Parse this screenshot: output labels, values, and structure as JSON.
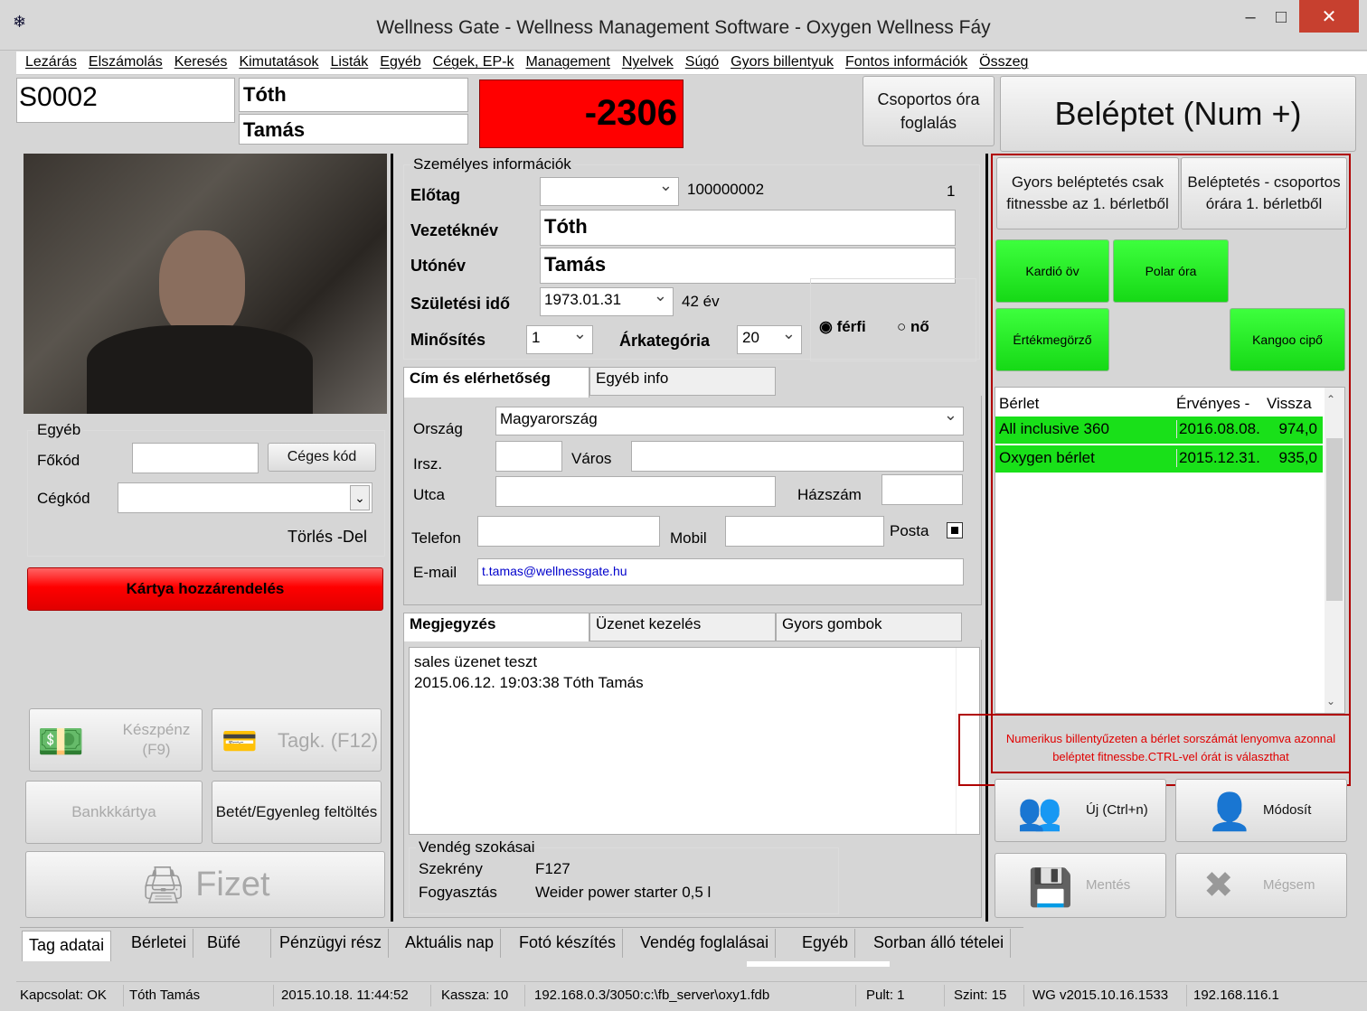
{
  "window": {
    "title": "Wellness Gate - Wellness Management Software - Oxygen Wellness Fáy"
  },
  "menu": [
    "Lezárás",
    "Elszámolás",
    "Keresés",
    "Kimutatások",
    "Listák",
    "Egyéb",
    "Cégek, EP-k",
    "Management",
    "Nyelvek",
    "Súgó",
    "Gyors billentyuk",
    "Fontos információk",
    "Összeg"
  ],
  "header": {
    "code": "S0002",
    "last_name": "Tóth",
    "first_name": "Tamás",
    "balance": "-2306",
    "group_booking": "Csoportos óra foglalás",
    "checkin": "Beléptet (Num +)"
  },
  "left": {
    "group_label": "Egyéb",
    "main_code_label": "Főkód",
    "company_code_button": "Céges kód",
    "company_code_label": "Cégkód",
    "delete_hint": "Törlés -Del",
    "card_assign": "Kártya hozzárendelés",
    "cash": "Készpénz (F9)",
    "member": "Tagk. (F12)",
    "bankcard": "Bankkkártya",
    "deposit": "Betét/Egyenleg feltöltés",
    "pay": "Fizet"
  },
  "personal": {
    "legend": "Személyes információk",
    "prefix_label": "Előtag",
    "prefix_value": "",
    "id": "100000002",
    "count": "1",
    "lastname_label": "Vezetéknév",
    "lastname": "Tóth",
    "firstname_label": "Utónév",
    "firstname": "Tamás",
    "birth_label": "Születési idő",
    "birth": "1973.01.31",
    "age": "42 év",
    "rating_label": "Minősítés",
    "rating": "1",
    "price_label": "Árkategória",
    "price": "20",
    "male": "férfi",
    "female": "nő"
  },
  "address_tabs": {
    "tab1": "Cím és elérhetőség",
    "tab2": "Egyéb info"
  },
  "address": {
    "country_label": "Ország",
    "country": "Magyarország",
    "zip_label": "Irsz.",
    "city_label": "Város",
    "street_label": "Utca",
    "house_label": "Házszám",
    "phone_label": "Telefon",
    "mobile_label": "Mobil",
    "post_label": "Posta",
    "email_label": "E-mail",
    "email": "t.tamas@wellnessgate.hu"
  },
  "note_tabs": {
    "tab1": "Megjegyzés",
    "tab2": "Üzenet kezelés",
    "tab3": "Gyors gombok"
  },
  "notes": {
    "line1": "sales üzenet teszt",
    "line2": "2015.06.12. 19:03:38 Tóth Tamás"
  },
  "habits": {
    "legend": "Vendég szokásai",
    "locker_label": "Szekrény",
    "locker": "F127",
    "consumption_label": "Fogyasztás",
    "consumption": "Weider power starter 0,5 l"
  },
  "right": {
    "quick_fitness": "Gyors beléptetés csak fitnessbe az 1. bérletből",
    "group_class": "Beléptetés - csoportos órára 1. bérletből",
    "kardio": "Kardió öv",
    "polar": "Polar óra",
    "valuables": "Értékmegörző",
    "kangoo": "Kangoo cipő",
    "table_headers": [
      "Bérlet",
      "Érvényes -",
      "Vissza"
    ],
    "passes": [
      {
        "name": "All inclusive 360",
        "valid": "2016.08.08.",
        "back": "974,0"
      },
      {
        "name": "Oxygen bérlet",
        "valid": "2015.12.31.",
        "back": "935,0"
      }
    ],
    "hint": "Numerikus billentyűzeten a bérlet sorszámát lenyomva azonnal beléptet fitnessbe.CTRL-vel órát is választhat",
    "new": "Új (Ctrl+n)",
    "modify": "Módosít",
    "save": "Mentés",
    "cancel": "Mégsem"
  },
  "bottom_tabs": [
    "Tag adatai",
    "Bérletei",
    "Büfé",
    "Pénzügyi rész",
    "Aktuális nap",
    "Fotó készítés",
    "Vendég foglalásai",
    "Egyéb",
    "Sorban álló tételei"
  ],
  "status": {
    "conn": "Kapcsolat: OK",
    "user": "Tóth Tamás",
    "datetime": "2015.10.18. 11:44:52",
    "till": "Kassza: 10",
    "db": "192.168.0.3/3050:c:\\fb_server\\oxy1.fdb",
    "desk": "Pult: 1",
    "level": "Szint: 15",
    "version": "WG v2015.10.16.1533",
    "ip": "192.168.116.1"
  },
  "colors": {
    "balance_bg": "#ff0000",
    "green": "#19e019",
    "highlight_red": "#cc0000",
    "link_blue": "#0000cc"
  }
}
